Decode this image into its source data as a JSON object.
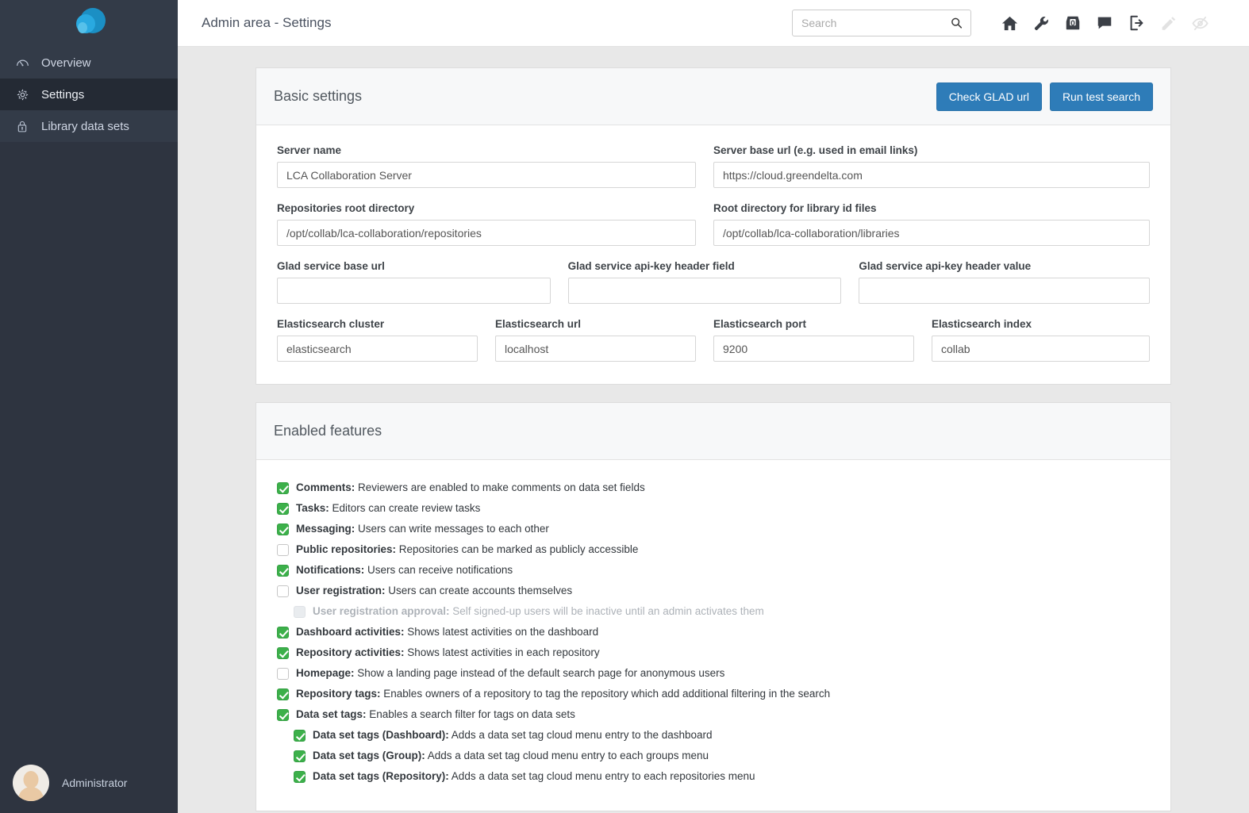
{
  "sidebar": {
    "logo_name": "collaboration-server-logo",
    "items": [
      {
        "label": "Overview",
        "icon": "dashboard-icon",
        "active": false
      },
      {
        "label": "Settings",
        "icon": "gear-icon",
        "active": true
      },
      {
        "label": "Library data sets",
        "icon": "lock-icon",
        "active": false
      }
    ],
    "user": {
      "name": "Administrator",
      "avatar": "user-avatar"
    }
  },
  "header": {
    "title": "Admin area - Settings",
    "search": {
      "placeholder": "Search",
      "value": ""
    },
    "icons": [
      {
        "name": "home-icon",
        "muted": false
      },
      {
        "name": "wrench-icon",
        "muted": false
      },
      {
        "name": "inbox-icon",
        "muted": false,
        "count": "0"
      },
      {
        "name": "comment-icon",
        "muted": false
      },
      {
        "name": "logout-icon",
        "muted": false
      },
      {
        "name": "pencil-icon",
        "muted": true
      },
      {
        "name": "eye-slash-icon",
        "muted": true
      }
    ]
  },
  "basic_settings": {
    "title": "Basic settings",
    "buttons": {
      "check_glad": "Check GLAD url",
      "run_test_search": "Run test search"
    },
    "fields": {
      "server_name": {
        "label": "Server name",
        "value": "LCA Collaboration Server"
      },
      "server_base_url": {
        "label": "Server base url (e.g. used in email links)",
        "value": "https://cloud.greendelta.com"
      },
      "repositories_root": {
        "label": "Repositories root directory",
        "value": "/opt/collab/lca-collaboration/repositories"
      },
      "library_root": {
        "label": "Root directory for library id files",
        "value": "/opt/collab/lca-collaboration/libraries"
      },
      "glad_base_url": {
        "label": "Glad service base url",
        "value": ""
      },
      "glad_api_key_field": {
        "label": "Glad service api-key header field",
        "value": ""
      },
      "glad_api_key_value": {
        "label": "Glad service api-key header value",
        "value": ""
      },
      "es_cluster": {
        "label": "Elasticsearch cluster",
        "value": "elasticsearch"
      },
      "es_url": {
        "label": "Elasticsearch url",
        "value": "localhost"
      },
      "es_port": {
        "label": "Elasticsearch port",
        "value": "9200"
      },
      "es_index": {
        "label": "Elasticsearch index",
        "value": "collab"
      }
    }
  },
  "enabled_features": {
    "title": "Enabled features",
    "items": [
      {
        "name": "Comments:",
        "desc": " Reviewers are enabled to make comments on data set fields",
        "checked": true,
        "indent": false,
        "disabled": false
      },
      {
        "name": "Tasks:",
        "desc": " Editors can create review tasks",
        "checked": true,
        "indent": false,
        "disabled": false
      },
      {
        "name": "Messaging:",
        "desc": " Users can write messages to each other",
        "checked": true,
        "indent": false,
        "disabled": false
      },
      {
        "name": "Public repositories:",
        "desc": " Repositories can be marked as publicly accessible",
        "checked": false,
        "indent": false,
        "disabled": false
      },
      {
        "name": "Notifications:",
        "desc": " Users can receive notifications",
        "checked": true,
        "indent": false,
        "disabled": false
      },
      {
        "name": "User registration:",
        "desc": " Users can create accounts themselves",
        "checked": false,
        "indent": false,
        "disabled": false
      },
      {
        "name": "User registration approval:",
        "desc": " Self signed-up users will be inactive until an admin activates them",
        "checked": false,
        "indent": true,
        "disabled": true
      },
      {
        "name": "Dashboard activities:",
        "desc": " Shows latest activities on the dashboard",
        "checked": true,
        "indent": false,
        "disabled": false
      },
      {
        "name": "Repository activities:",
        "desc": " Shows latest activities in each repository",
        "checked": true,
        "indent": false,
        "disabled": false
      },
      {
        "name": "Homepage:",
        "desc": " Show a landing page instead of the default search page for anonymous users",
        "checked": false,
        "indent": false,
        "disabled": false
      },
      {
        "name": "Repository tags:",
        "desc": " Enables owners of a repository to tag the repository which add additional filtering in the search",
        "checked": true,
        "indent": false,
        "disabled": false
      },
      {
        "name": "Data set tags:",
        "desc": " Enables a search filter for tags on data sets",
        "checked": true,
        "indent": false,
        "disabled": false
      },
      {
        "name": "Data set tags (Dashboard):",
        "desc": " Adds a data set tag cloud menu entry to the dashboard",
        "checked": true,
        "indent": true,
        "disabled": false
      },
      {
        "name": "Data set tags (Group):",
        "desc": " Adds a data set tag cloud menu entry to each groups menu",
        "checked": true,
        "indent": true,
        "disabled": false
      },
      {
        "name": "Data set tags (Repository):",
        "desc": " Adds a data set tag cloud menu entry to each repositories menu",
        "checked": true,
        "indent": true,
        "disabled": false
      }
    ]
  },
  "colors": {
    "sidebar_bg": "#2e3440",
    "sidebar_item_bg": "#333b48",
    "sidebar_active_bg": "#242a34",
    "accent_blue": "#2e7cb8",
    "check_green": "#3cb04a",
    "page_bg": "#e8e8e8",
    "logo_blue_dark": "#1b8fc4",
    "logo_blue_light": "#29a9e0"
  }
}
